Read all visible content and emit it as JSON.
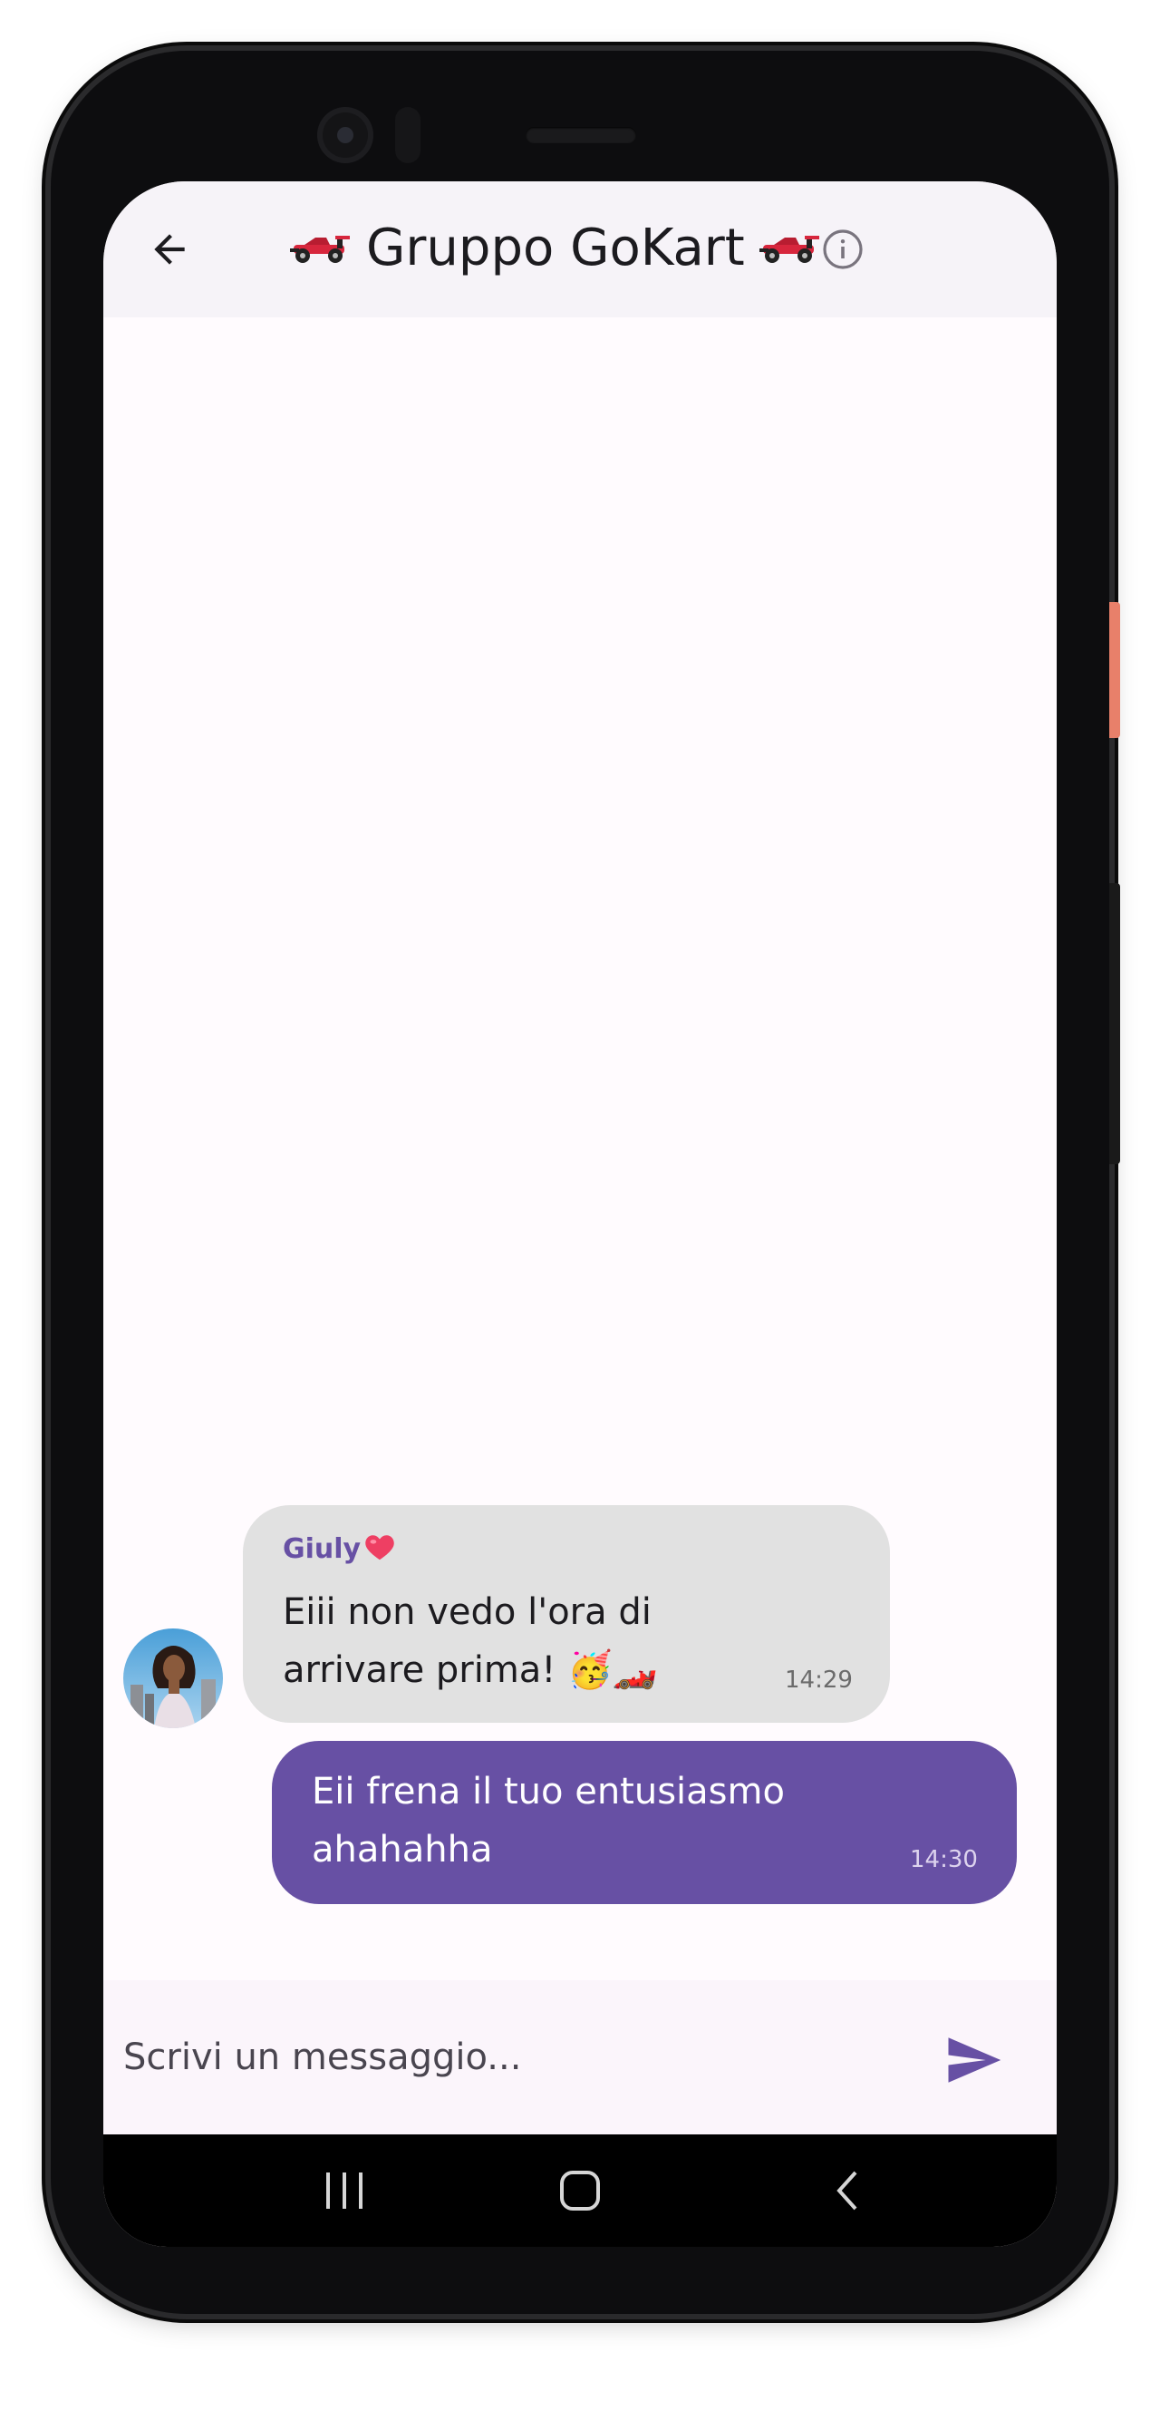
{
  "header": {
    "title": "Gruppo GoKart",
    "title_emoji": "race-car",
    "back_icon": "arrow-left-icon",
    "info_icon": "info-icon"
  },
  "messages": [
    {
      "direction": "incoming",
      "sender": "Giuly",
      "sender_emoji": "red-heart",
      "text": "Eiii non vedo l'ora di arrivare prima! 🥳🏎️",
      "time": "14:29",
      "avatar": "user-avatar-photo"
    },
    {
      "direction": "outgoing",
      "text": "Eii frena il tuo entusiasmo ahahahha",
      "time": "14:30"
    }
  ],
  "composer": {
    "placeholder": "Scrivi un messaggio...",
    "value": "",
    "send_icon": "send-icon"
  },
  "navigation_bar": {
    "recents_icon": "recents-icon",
    "home_icon": "home-icon",
    "back_icon": "back-chevron-icon"
  },
  "colors": {
    "accent": "#6750a4",
    "incoming_bubble": "#e1e1e1",
    "outgoing_bubble": "#6750a4",
    "app_bar": "#f6f3f8",
    "composer_bg": "#fbf5fb"
  }
}
